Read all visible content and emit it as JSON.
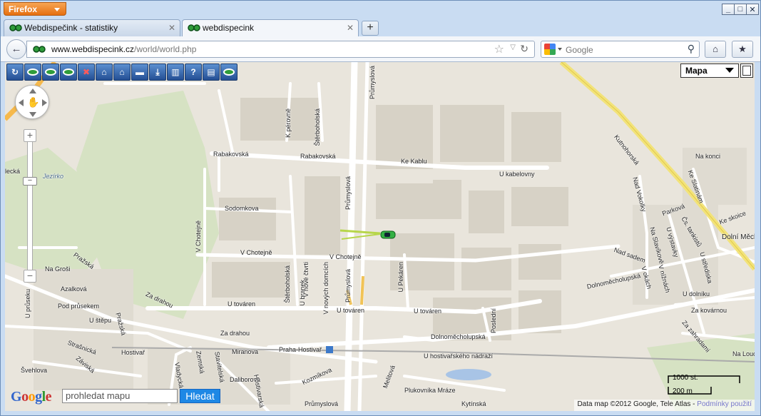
{
  "browser": {
    "app_button": "Firefox",
    "tabs": [
      {
        "title": "Webdispečink - statistiky"
      },
      {
        "title": "webdispecink"
      }
    ],
    "url_domain": "www.webdispecink.cz",
    "url_path": "/world/world.php",
    "search_placeholder": "Google"
  },
  "map": {
    "map_type": "Mapa",
    "search_placeholder": "prohledat mapu",
    "search_button": "Hledat",
    "logo_letters": [
      "G",
      "o",
      "o",
      "g",
      "l",
      "e"
    ],
    "scale_top": "1000 st.",
    "scale_bottom": "200 m",
    "attribution": "Data map ©2012 Google, Tele Atlas - ",
    "terms_link": "Podmínky použití",
    "tools": [
      "reload-icon",
      "eye-icon",
      "eye-add-icon",
      "eye-add-icon",
      "no-vehicle-icon",
      "home-icon",
      "home-add-icon",
      "vehicle-icon",
      "download-icon",
      "chart-icon",
      "help-icon",
      "print-icon",
      "eye-settings-icon"
    ],
    "streets": {
      "prumyslova_top": "Průmyslová",
      "k_perovne": "K pérovně",
      "sterbohol_top": "Štěrboholská",
      "rabakovska1": "Rabakovská",
      "rabakovska2": "Rabakovská",
      "ke_kablu": "Ke Kablu",
      "u_kabelovny": "U kabelovny",
      "kutnohorska": "Kutnohorská",
      "na_konci": "Na konci",
      "ke_slatinam": "Ke Slatinám",
      "ke_skoice": "Ke skoice",
      "dolni_mecholupy": "Dolní Měcholupy",
      "nad_vokolky": "Nad Vokolky",
      "parkova": "Parková",
      "cs_tankistu": "Čs. tankistů",
      "u_vystavky": "U výstavky",
      "na_slavikove": "Na Slavíkově",
      "u_stredniska": "U střediska",
      "nad_sadem": "Nad sadem",
      "v_okach": "V okách",
      "v_niznach": "V nížnách",
      "u_dolniku": "U dolníku",
      "dolnomecholupska": "Dolnoměcholupská",
      "za_kovarnou": "Za kovárnou",
      "za_zahradami": "Za zahradami",
      "na_louce": "Na Louce",
      "lecka": "lecká",
      "jezirko": "Jezírko",
      "sodomkova": "Sodomkova",
      "v_chotejne_v": "V Chotejně",
      "v_chotejne_h": "V Chotejně",
      "v_chotejne_h2": "V Chotejně",
      "prumyslova_mid": "Průmyslová",
      "prazska1": "Pražská",
      "na_grosi": "Na Groši",
      "azalkova": "Azalková",
      "u_prusek": "U průseku",
      "pod_pruseken": "Pod průsekem",
      "u_stepu": "U štěpu",
      "za_drahou1": "Za drahou",
      "za_drahou2": "Za drahou",
      "sterbohol_mid": "Štěrboholská",
      "u_branek": "U branek",
      "v_nove_ctvrti": "V nové čtvrti",
      "v_novych_domcich": "V nových domcích",
      "prumyslova_low": "Průmyslová",
      "u_tovaren1": "U továren",
      "u_tovaren2": "U továren",
      "u_tovaren3": "U továren",
      "u_pekaren": "U Pekáren",
      "posledni": "Poslední",
      "dolnomecholupska2": "Dolnoměcholupská",
      "prazska2": "Pražská",
      "strasnicka": "Strašnická",
      "hostivar": "Hostivař",
      "zavisska": "Záviská",
      "svehlova": "Švehlova",
      "miranova": "Miranova",
      "praha_hostivar": "Praha-Hostivař",
      "u_hostivarskeho": "U hostivařského nádraží",
      "vladycka": "Vladycká",
      "zemska": "Zemská",
      "stavitelska": "Stavitelská",
      "dalibrova": "Daliborova",
      "hostivarska": "Hostivarská",
      "kozmikova": "Kozmíkova",
      "plukovnika": "Plukovníka Mráze",
      "prumyslova_bot": "Průmyslová",
      "melitova": "Melitová",
      "kytinska": "Kytínská"
    }
  }
}
